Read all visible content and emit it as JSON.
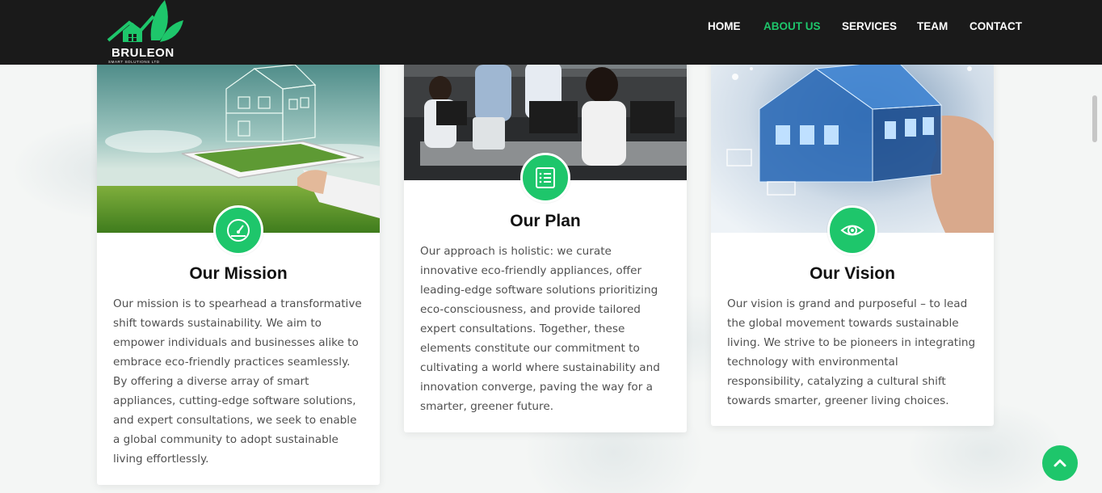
{
  "brand": {
    "name": "BRULEON",
    "tagline": "SMART SOLUTIONS LTD",
    "accent": "#1ec66b"
  },
  "nav": {
    "items": [
      {
        "label": "HOME",
        "active": false
      },
      {
        "label": "ABOUT US",
        "active": true
      },
      {
        "label": "SERVICES",
        "active": false
      },
      {
        "label": "TEAM",
        "active": false
      },
      {
        "label": "CONTACT",
        "active": false
      }
    ]
  },
  "cards": {
    "mission": {
      "title": "Our Mission",
      "icon": "speedometer-icon",
      "image": "tablet-house-field-photo",
      "text": "Our mission is to spearhead a transformative shift towards sustainability. We aim to empower individuals and businesses alike to embrace eco-friendly practices seamlessly. By offering a diverse array of smart appliances, cutting-edge software solutions, and expert consultations, we seek to enable a global community to adopt sustainable living effortlessly."
    },
    "plan": {
      "title": "Our Plan",
      "icon": "list-document-icon",
      "image": "office-team-photo",
      "text": "Our approach is holistic: we curate innovative eco-friendly appliances, offer leading-edge software solutions prioritizing eco-consciousness, and provide tailored expert consultations. Together, these elements constitute our commitment to cultivating a world where sustainability and innovation converge, paving the way for a smarter, greener future."
    },
    "vision": {
      "title": "Our Vision",
      "icon": "eye-icon",
      "image": "holographic-house-photo",
      "text": "Our vision is grand and purposeful – to lead the global movement towards sustainable living. We strive to be pioneers in integrating technology with environmental responsibility, catalyzing a cultural shift towards smarter, greener living choices."
    }
  },
  "scroll_top": {
    "icon": "chevron-up-icon"
  }
}
